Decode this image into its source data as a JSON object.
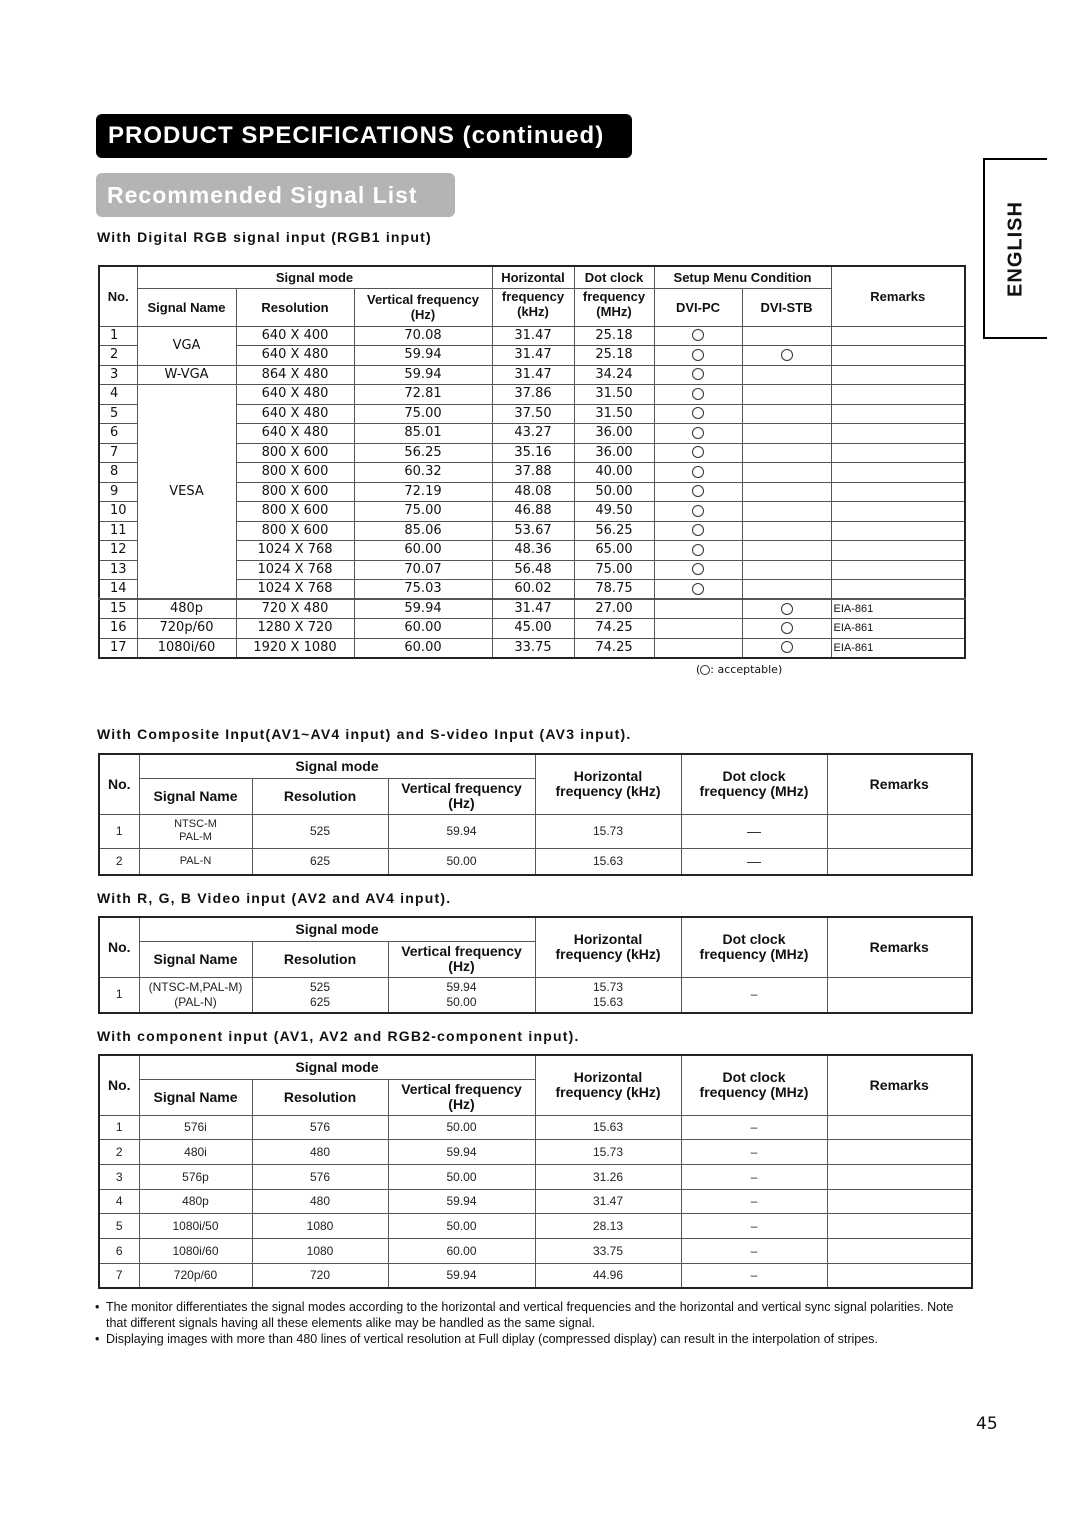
{
  "header": {
    "title": "PRODUCT SPECIFICATIONS (continued)",
    "subtitle": "Recommended Signal List",
    "language_tab": "ENGLISH"
  },
  "digital_rgb": {
    "heading": "With Digital RGB signal input (RGB1 input)",
    "headers": {
      "no": "No.",
      "signal_mode": "Signal mode",
      "signal_name": "Signal Name",
      "resolution": "Resolution",
      "vfreq": "Vertical frequency",
      "vfreq_unit": "(Hz)",
      "hfreq_1": "Horizontal",
      "hfreq_2": "frequency",
      "hfreq_unit": "(kHz)",
      "dot_1": "Dot clock",
      "dot_2": "frequency",
      "dot_unit": "(MHz)",
      "setup": "Setup Menu Condition",
      "dvi_pc": "DVI-PC",
      "dvi_stb": "DVI-STB",
      "remarks": "Remarks"
    },
    "groups": [
      {
        "name": "VGA",
        "rows": [
          1,
          2
        ]
      },
      {
        "name": "W-VGA",
        "rows": [
          3
        ]
      },
      {
        "name": "VESA",
        "rows": [
          4,
          5,
          6,
          7,
          8,
          9,
          10,
          11,
          12,
          13,
          14
        ]
      },
      {
        "name": "480p",
        "rows": [
          15
        ]
      },
      {
        "name": "720p/60",
        "rows": [
          16
        ]
      },
      {
        "name": "1080i/60",
        "rows": [
          17
        ]
      }
    ],
    "rows": [
      {
        "no": "1",
        "resolution": "640 X 400",
        "vfreq": "70.08",
        "hfreq": "31.47",
        "dot": "25.18",
        "dvi_pc": true,
        "dvi_stb": false,
        "remarks": ""
      },
      {
        "no": "2",
        "resolution": "640 X 480",
        "vfreq": "59.94",
        "hfreq": "31.47",
        "dot": "25.18",
        "dvi_pc": true,
        "dvi_stb": true,
        "remarks": ""
      },
      {
        "no": "3",
        "resolution": "864 X 480",
        "vfreq": "59.94",
        "hfreq": "31.47",
        "dot": "34.24",
        "dvi_pc": true,
        "dvi_stb": false,
        "remarks": ""
      },
      {
        "no": "4",
        "resolution": "640 X 480",
        "vfreq": "72.81",
        "hfreq": "37.86",
        "dot": "31.50",
        "dvi_pc": true,
        "dvi_stb": false,
        "remarks": ""
      },
      {
        "no": "5",
        "resolution": "640 X 480",
        "vfreq": "75.00",
        "hfreq": "37.50",
        "dot": "31.50",
        "dvi_pc": true,
        "dvi_stb": false,
        "remarks": ""
      },
      {
        "no": "6",
        "resolution": "640 X 480",
        "vfreq": "85.01",
        "hfreq": "43.27",
        "dot": "36.00",
        "dvi_pc": true,
        "dvi_stb": false,
        "remarks": ""
      },
      {
        "no": "7",
        "resolution": "800 X 600",
        "vfreq": "56.25",
        "hfreq": "35.16",
        "dot": "36.00",
        "dvi_pc": true,
        "dvi_stb": false,
        "remarks": ""
      },
      {
        "no": "8",
        "resolution": "800 X 600",
        "vfreq": "60.32",
        "hfreq": "37.88",
        "dot": "40.00",
        "dvi_pc": true,
        "dvi_stb": false,
        "remarks": ""
      },
      {
        "no": "9",
        "resolution": "800 X 600",
        "vfreq": "72.19",
        "hfreq": "48.08",
        "dot": "50.00",
        "dvi_pc": true,
        "dvi_stb": false,
        "remarks": ""
      },
      {
        "no": "10",
        "resolution": "800 X 600",
        "vfreq": "75.00",
        "hfreq": "46.88",
        "dot": "49.50",
        "dvi_pc": true,
        "dvi_stb": false,
        "remarks": ""
      },
      {
        "no": "11",
        "resolution": "800 X 600",
        "vfreq": "85.06",
        "hfreq": "53.67",
        "dot": "56.25",
        "dvi_pc": true,
        "dvi_stb": false,
        "remarks": ""
      },
      {
        "no": "12",
        "resolution": "1024 X 768",
        "vfreq": "60.00",
        "hfreq": "48.36",
        "dot": "65.00",
        "dvi_pc": true,
        "dvi_stb": false,
        "remarks": ""
      },
      {
        "no": "13",
        "resolution": "1024 X 768",
        "vfreq": "70.07",
        "hfreq": "56.48",
        "dot": "75.00",
        "dvi_pc": true,
        "dvi_stb": false,
        "remarks": ""
      },
      {
        "no": "14",
        "resolution": "1024 X 768",
        "vfreq": "75.03",
        "hfreq": "60.02",
        "dot": "78.75",
        "dvi_pc": true,
        "dvi_stb": false,
        "remarks": ""
      },
      {
        "no": "15",
        "resolution": "720 X 480",
        "vfreq": "59.94",
        "hfreq": "31.47",
        "dot": "27.00",
        "dvi_pc": false,
        "dvi_stb": true,
        "remarks": "EIA-861"
      },
      {
        "no": "16",
        "resolution": "1280 X 720",
        "vfreq": "60.00",
        "hfreq": "45.00",
        "dot": "74.25",
        "dvi_pc": false,
        "dvi_stb": true,
        "remarks": "EIA-861"
      },
      {
        "no": "17",
        "resolution": "1920 X 1080",
        "vfreq": "60.00",
        "hfreq": "33.75",
        "dot": "74.25",
        "dvi_pc": false,
        "dvi_stb": true,
        "remarks": "EIA-861"
      }
    ],
    "legend_open": "(",
    "legend_text": ": acceptable)",
    "acceptable_icon": "circle-icon"
  },
  "video_headers": {
    "no": "No.",
    "signal_mode": "Signal mode",
    "signal_name": "Signal Name",
    "resolution": "Resolution",
    "vfreq": "Vertical frequency",
    "vfreq_unit": "(Hz)",
    "hfreq_1": "Horizontal",
    "hfreq_2": "frequency (kHz)",
    "dot_1": "Dot clock",
    "dot_2": "frequency (MHz)",
    "remarks": "Remarks"
  },
  "composite": {
    "heading": "With Composite Input(AV1~AV4 input) and S-video Input (AV3 input).",
    "rows": [
      {
        "no": "1",
        "name_1": "NTSC-M",
        "name_2": "PAL-M",
        "resolution": "525",
        "vfreq": "59.94",
        "hfreq": "15.73",
        "dot": "—",
        "remarks": ""
      },
      {
        "no": "2",
        "name_1": "PAL-N",
        "name_2": "",
        "resolution": "625",
        "vfreq": "50.00",
        "hfreq": "15.63",
        "dot": "—",
        "remarks": ""
      }
    ]
  },
  "rgb_video": {
    "heading": "With R, G, B Video input (AV2 and AV4 input).",
    "rows": [
      {
        "no": "1",
        "name_1": "(NTSC-M,PAL-M)",
        "name_2": "(PAL-N)",
        "res_1": "525",
        "res_2": "625",
        "vfreq_1": "59.94",
        "vfreq_2": "50.00",
        "hfreq_1": "15.73",
        "hfreq_2": "15.63",
        "dot": "–",
        "remarks": ""
      }
    ]
  },
  "component": {
    "heading": "With component input (AV1, AV2 and RGB2-component input).",
    "rows": [
      {
        "no": "1",
        "name": "576i",
        "resolution": "576",
        "vfreq": "50.00",
        "hfreq": "15.63",
        "dot": "–",
        "remarks": ""
      },
      {
        "no": "2",
        "name": "480i",
        "resolution": "480",
        "vfreq": "59.94",
        "hfreq": "15.73",
        "dot": "–",
        "remarks": ""
      },
      {
        "no": "3",
        "name": "576p",
        "resolution": "576",
        "vfreq": "50.00",
        "hfreq": "31.26",
        "dot": "–",
        "remarks": ""
      },
      {
        "no": "4",
        "name": "480p",
        "resolution": "480",
        "vfreq": "59.94",
        "hfreq": "31.47",
        "dot": "–",
        "remarks": ""
      },
      {
        "no": "5",
        "name": "1080i/50",
        "resolution": "1080",
        "vfreq": "50.00",
        "hfreq": "28.13",
        "dot": "–",
        "remarks": ""
      },
      {
        "no": "6",
        "name": "1080i/60",
        "resolution": "1080",
        "vfreq": "60.00",
        "hfreq": "33.75",
        "dot": "–",
        "remarks": ""
      },
      {
        "no": "7",
        "name": "720p/60",
        "resolution": "720",
        "vfreq": "59.94",
        "hfreq": "44.96",
        "dot": "–",
        "remarks": ""
      }
    ]
  },
  "notes": [
    "The monitor differentiates the signal modes according to the horizontal and vertical frequencies and the horizontal and vertical sync signal polarities.  Note that different signals having all these elements alike may be handled as the same signal.",
    "Displaying images with more than 480 lines of vertical resolution at Full diplay (compressed display) can result in the interpolation of stripes."
  ],
  "page_number": "45"
}
